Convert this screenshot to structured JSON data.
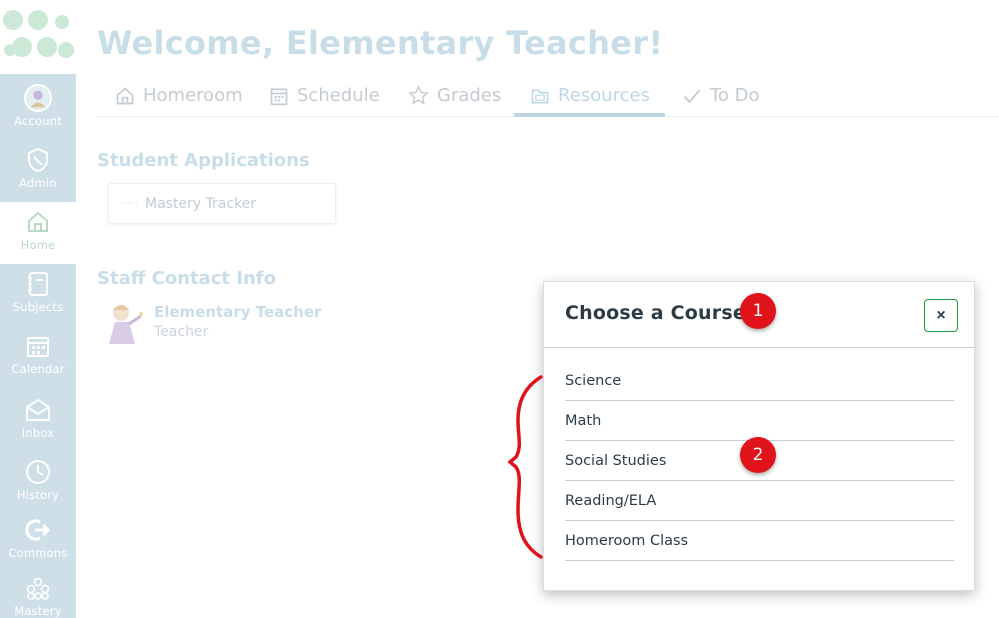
{
  "page": {
    "title": "Welcome, Elementary Teacher!"
  },
  "sidebar": {
    "items": [
      {
        "label": "Account",
        "icon": "avatar-icon"
      },
      {
        "label": "Admin",
        "icon": "shield-icon"
      },
      {
        "label": "Home",
        "icon": "home-icon"
      },
      {
        "label": "Subjects",
        "icon": "notebook-icon"
      },
      {
        "label": "Calendar",
        "icon": "calendar-icon"
      },
      {
        "label": "Inbox",
        "icon": "inbox-icon"
      },
      {
        "label": "History",
        "icon": "clock-icon"
      },
      {
        "label": "Commons",
        "icon": "commons-icon"
      },
      {
        "label": "Mastery",
        "icon": "mastery-icon"
      }
    ],
    "active": "Home"
  },
  "tabs": {
    "items": [
      {
        "label": "Homeroom",
        "icon": "home-icon"
      },
      {
        "label": "Schedule",
        "icon": "calendar-icon"
      },
      {
        "label": "Grades",
        "icon": "star-icon"
      },
      {
        "label": "Resources",
        "icon": "folder-icon"
      },
      {
        "label": "To Do",
        "icon": "check-icon"
      }
    ],
    "active": "Resources"
  },
  "student_apps": {
    "heading": "Student Applications",
    "items": [
      {
        "label": "Mastery Tracker"
      }
    ]
  },
  "staff": {
    "heading": "Staff Contact Info",
    "contacts": [
      {
        "name": "Elementary Teacher",
        "role": "Teacher"
      }
    ]
  },
  "modal": {
    "title": "Choose a Course",
    "close_label": "×",
    "courses": [
      {
        "label": "Science"
      },
      {
        "label": "Math"
      },
      {
        "label": "Social Studies"
      },
      {
        "label": "Reading/ELA"
      },
      {
        "label": "Homeroom Class"
      }
    ]
  },
  "annotations": {
    "badges": [
      {
        "label": "1"
      },
      {
        "label": "2"
      }
    ]
  },
  "colors": {
    "accent_green": "#1f9a3d",
    "annotation_red": "#e0131b",
    "sidebar_bg": "#cfdfe8"
  }
}
